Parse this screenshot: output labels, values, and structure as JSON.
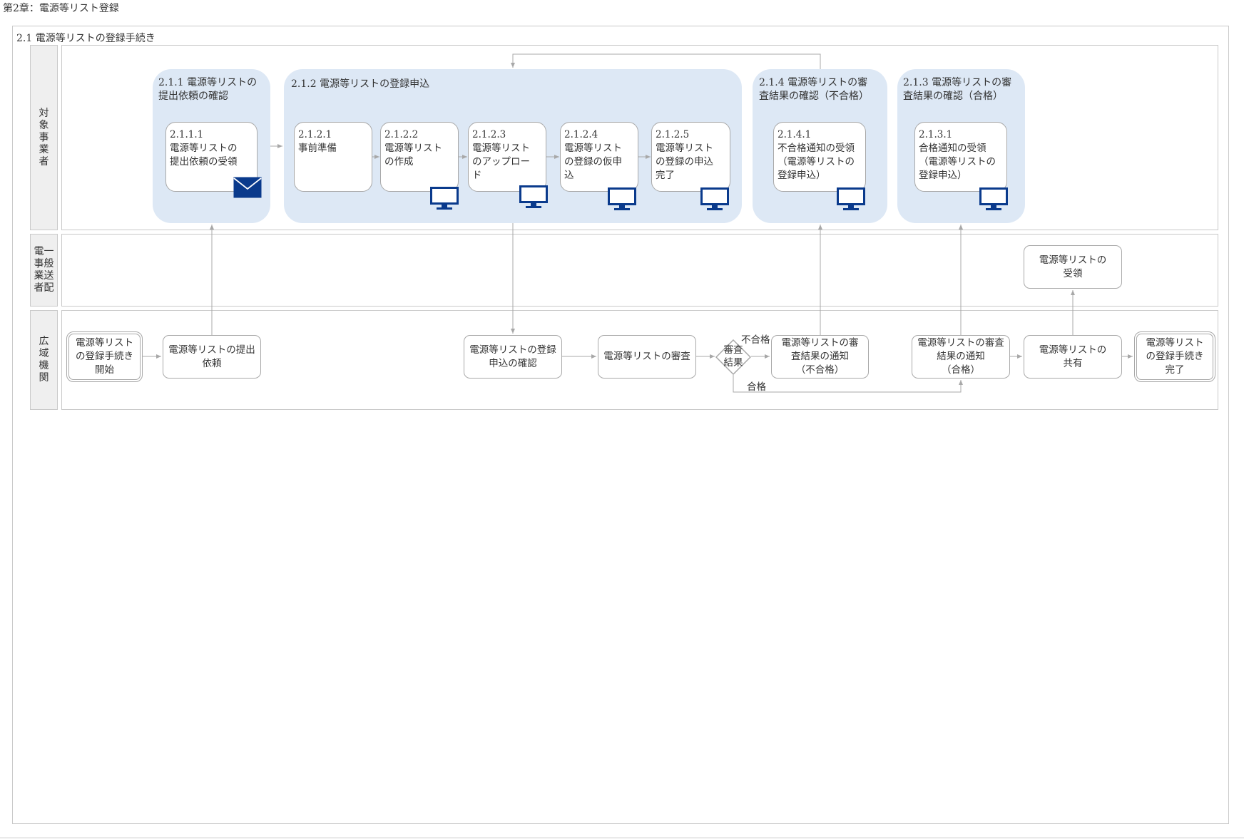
{
  "page_title": "第2章：電源等リスト登録",
  "section_title": "2.1 電源等リストの登録手続き",
  "lanes": {
    "target": [
      "対",
      "象",
      "事",
      "業",
      "者"
    ],
    "td_col1": [
      "一",
      "般",
      "送",
      "配"
    ],
    "td_col2": [
      "電",
      "事",
      "業",
      "者"
    ],
    "occto": [
      "広",
      "域",
      "機",
      "関"
    ]
  },
  "groups": {
    "g211": "2.1.1 電源等リストの\n提出依頼の確認",
    "g212": "2.1.2 電源等リストの登録申込",
    "g214": "2.1.4 電源等リストの審\n査結果の確認（不合格）",
    "g213": "2.1.3 電源等リストの審\n査結果の確認（合格）"
  },
  "tasks": {
    "t2111": "2.1.1.1\n電源等リストの\n提出依頼の受領",
    "t2121": "2.1.2.1\n事前準備",
    "t2122": "2.1.2.2\n電源等リスト\nの作成",
    "t2123": "2.1.2.3\n電源等リスト\nのアップロー\nド",
    "t2124": "2.1.2.4\n電源等リスト\nの登録の仮申\n込",
    "t2125": "2.1.2.5\n電源等リスト\nの登録の申込\n完了",
    "t2141": "2.1.4.1\n不合格通知の受領\n（電源等リストの\n登録申込）",
    "t2131": "2.1.3.1\n合格通知の受領\n（電源等リストの\n登録申込）"
  },
  "nodes": {
    "start": "電源等リスト\nの登録手続き\n開始",
    "request": "電源等リストの提出\n依頼",
    "confirm": "電源等リストの登録\n申込の確認",
    "review": "電源等リストの審査",
    "decision": "審査\n結果",
    "notify_fail": "電源等リストの審\n査結果の通知\n（不合格）",
    "notify_pass": "電源等リストの審査\n結果の通知\n（合格）",
    "share": "電源等リストの\n共有",
    "td_receive": "電源等リストの\n受領",
    "end": "電源等リスト\nの登録手続き\n完了"
  },
  "labels": {
    "fail": "不合格",
    "pass": "合格"
  },
  "icons": {
    "mail": "mail-icon",
    "monitor": "monitor-icon",
    "color": "#0a3a8c"
  }
}
